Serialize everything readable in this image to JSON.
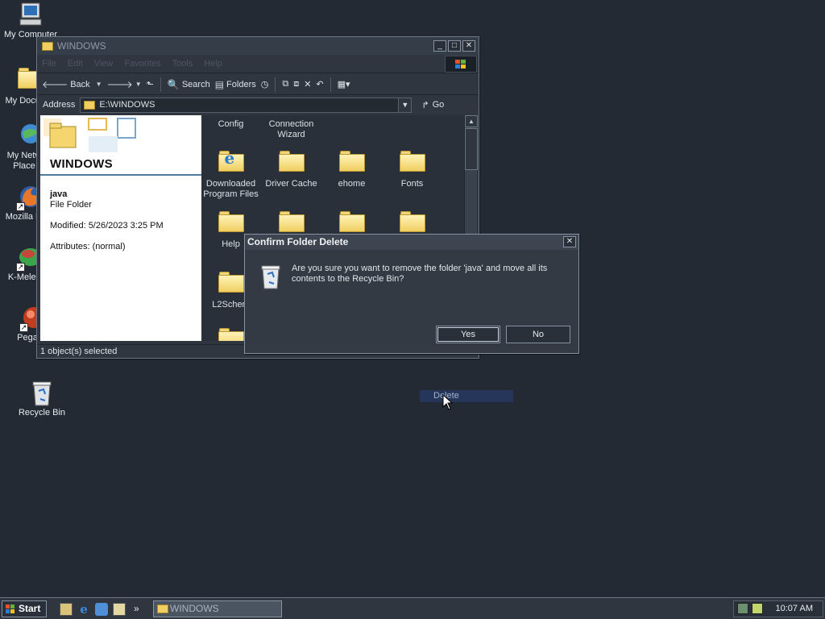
{
  "desktop": {
    "icons": [
      {
        "label": "My Computer",
        "icon": "computer-icon"
      },
      {
        "label": "My Docur",
        "icon": "documents-folder-icon"
      },
      {
        "label": "My Netw\nPlace",
        "icon": "network-icon"
      },
      {
        "label": "Mozilla Fi",
        "icon": "firefox-icon"
      },
      {
        "label": "K-Melec",
        "icon": "kmeleon-icon"
      },
      {
        "label": "Pega",
        "icon": "app-icon"
      },
      {
        "label": "Recycle Bin",
        "icon": "recycle-bin-icon"
      }
    ]
  },
  "explorer": {
    "title": "WINDOWS",
    "menu": [
      "File",
      "Edit",
      "View",
      "Favorites",
      "Tools",
      "Help"
    ],
    "toolbar": {
      "back": "Back",
      "search": "Search",
      "folders": "Folders"
    },
    "address_label": "Address",
    "address_value": "E:\\WINDOWS",
    "go_label": "Go",
    "left_pane": {
      "title": "WINDOWS",
      "selected_name": "java",
      "selected_type": "File Folder",
      "modified": "Modified: 5/26/2023 3:25 PM",
      "attributes": "Attributes: (normal)"
    },
    "files": [
      {
        "name": "Config",
        "icon": "none"
      },
      {
        "name": "Connection Wizard",
        "icon": "none"
      },
      {
        "name": "Downloaded Program Files",
        "icon": "ie-icon"
      },
      {
        "name": "Driver Cache",
        "icon": "folder-icon"
      },
      {
        "name": "ehome",
        "icon": "folder-icon"
      },
      {
        "name": "Fonts",
        "icon": "folder-icon"
      },
      {
        "name": "Help",
        "icon": "folder-icon"
      },
      {
        "name": "",
        "icon": "folder-icon"
      },
      {
        "name": "",
        "icon": "folder-icon"
      },
      {
        "name": "",
        "icon": "folder-icon"
      },
      {
        "name": "L2Schem",
        "icon": "folder-icon"
      },
      {
        "name": "",
        "icon": "folder-icon"
      }
    ],
    "status": "1 object(s) selected"
  },
  "dialog": {
    "title": "Confirm Folder Delete",
    "message": "Are you sure you want to remove the folder 'java' and move all its contents to the Recycle Bin?",
    "yes": "Yes",
    "no": "No"
  },
  "drag_label": "Delete",
  "taskbar": {
    "start": "Start",
    "task": "WINDOWS",
    "clock": "10:07 AM"
  },
  "colors": {
    "desktop": "#232a33",
    "window": "#2f3640",
    "accent": "#4d7a9d"
  }
}
